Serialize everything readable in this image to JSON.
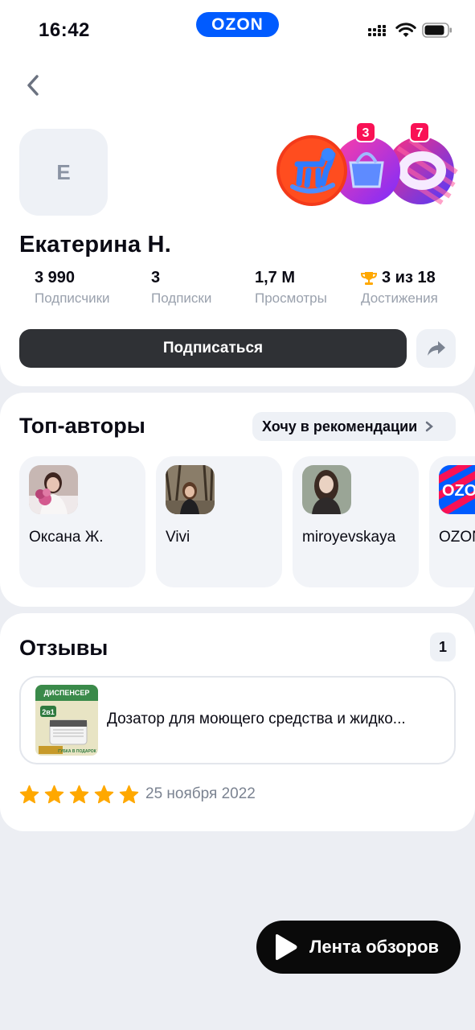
{
  "status_bar": {
    "time": "16:42",
    "app_badge": "OZON"
  },
  "profile": {
    "avatar_letter": "Е",
    "name": "Екатерина Н.",
    "badges": [
      {
        "icon": "rocking-horse-icon",
        "count": ""
      },
      {
        "icon": "basket-icon",
        "count": "3"
      },
      {
        "icon": "ozon-o-icon",
        "count": "7"
      }
    ],
    "stats": [
      {
        "value": "3 990",
        "label": "Подписчики"
      },
      {
        "value": "3",
        "label": "Подписки"
      },
      {
        "value": "1,7 M",
        "label": "Просмотры"
      },
      {
        "value": "3 из 18",
        "label": "Достижения",
        "icon": "trophy-icon"
      }
    ],
    "subscribe_label": "Подписаться"
  },
  "top_authors": {
    "title": "Топ-авторы",
    "recommend_label": "Хочу в рекомендации",
    "authors": [
      {
        "name": "Оксана Ж."
      },
      {
        "name": "Vivi"
      },
      {
        "name": "miroyevskaya"
      },
      {
        "name": "OZON"
      }
    ]
  },
  "reviews": {
    "title": "Отзывы",
    "count": "1",
    "item": {
      "product_title": "Дозатор для моющего средства и жидко...",
      "thumb_texts": [
        "ДИСПЕНСЕР",
        "2в1",
        "ГУБКА В ПОДАРОК"
      ]
    },
    "rating": 5,
    "date": "25 ноября 2022"
  },
  "feed_button_label": "Лента обзоров",
  "colors": {
    "brand": "#005bff",
    "accent_pink": "#f91155",
    "star": "#ffa800",
    "dark_button": "#2f3135"
  }
}
